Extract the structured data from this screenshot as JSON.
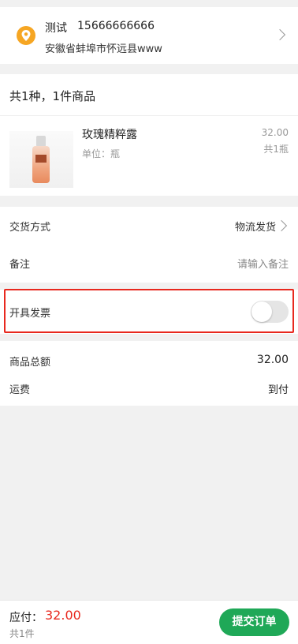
{
  "address": {
    "name": "测试",
    "phone": "15666666666",
    "detail": "安徽省蚌埠市怀远县www",
    "icon": "location-pin-icon"
  },
  "goods": {
    "summary": "共1种，1件商品",
    "items": [
      {
        "name": "玫瑰精粹露",
        "unit": "单位：瓶",
        "price": "32.00",
        "qty": "共1瓶"
      }
    ]
  },
  "options": {
    "delivery_label": "交货方式",
    "delivery_value": "物流发货",
    "remark_label": "备注",
    "remark_placeholder": "请输入备注"
  },
  "invoice": {
    "label": "开具发票",
    "enabled": false
  },
  "totals": {
    "goods_total_label": "商品总额",
    "goods_total_value": "32.00",
    "shipping_label": "运费",
    "shipping_value": "到付"
  },
  "bottom": {
    "pay_label": "应付：",
    "pay_amount": "32.00",
    "count": "共1件",
    "submit_label": "提交订单"
  },
  "colors": {
    "accent_green": "#1fa857",
    "price_red": "#e8281e",
    "location_orange": "#f6a623"
  }
}
